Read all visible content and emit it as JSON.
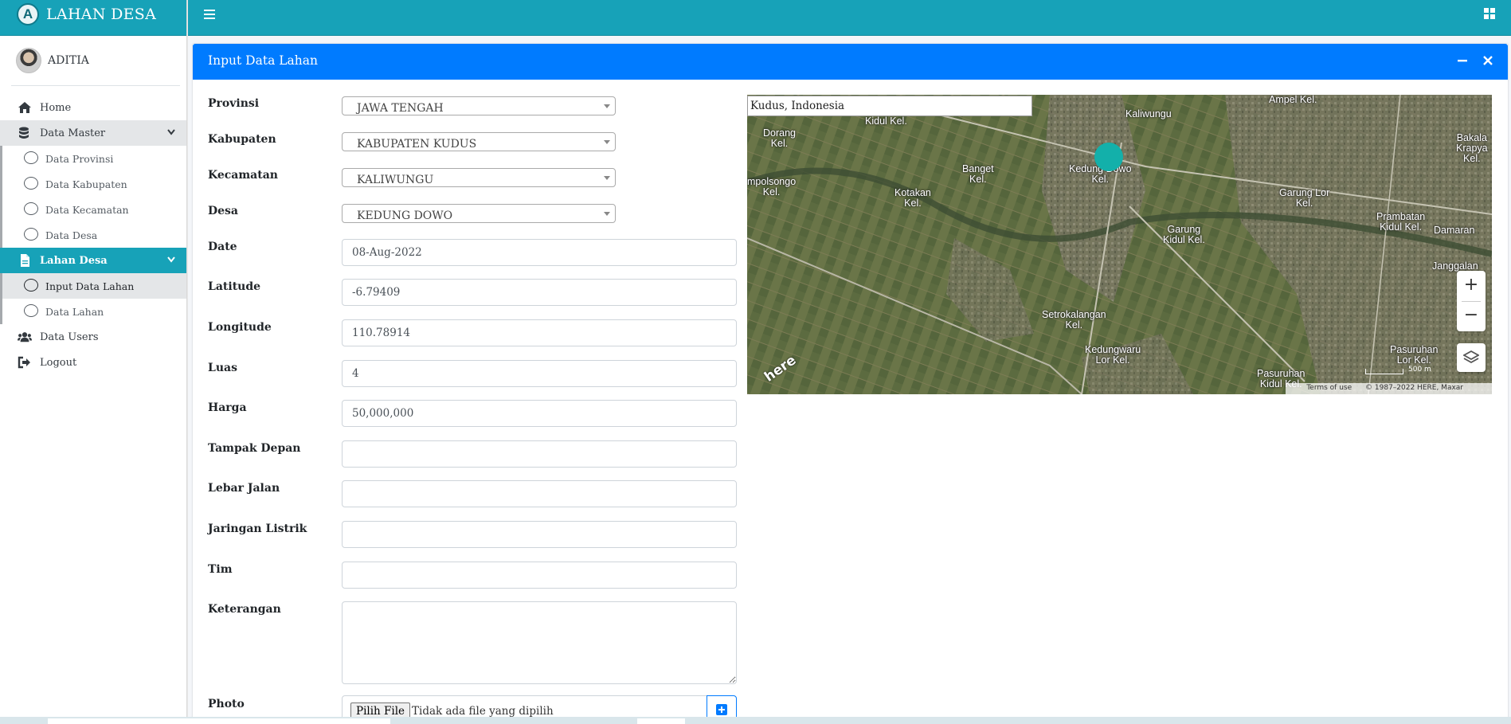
{
  "app": {
    "brand": "LAHAN DESA",
    "brand_logo_letter": "A",
    "user": "ADITIA"
  },
  "sidebar": {
    "items": [
      {
        "label": "Home",
        "icon": "home-icon"
      },
      {
        "label": "Data Master",
        "icon": "database-icon",
        "expanded": true,
        "children": [
          "Data Provinsi",
          "Data Kabupaten",
          "Data Kecamatan",
          "Data Desa"
        ]
      },
      {
        "label": "Lahan Desa",
        "icon": "file-icon",
        "expanded": true,
        "active": true,
        "children": [
          "Input Data Lahan",
          "Data Lahan"
        ],
        "active_child": "Input Data Lahan"
      },
      {
        "label": "Data Users",
        "icon": "users-icon"
      },
      {
        "label": "Logout",
        "icon": "sign-out-icon"
      }
    ]
  },
  "card": {
    "title": "Input Data Lahan"
  },
  "form": {
    "provinsi": {
      "label": "Provinsi",
      "value": "JAWA TENGAH"
    },
    "kabupaten": {
      "label": "Kabupaten",
      "value": "KABUPATEN KUDUS"
    },
    "kecamatan": {
      "label": "Kecamatan",
      "value": "KALIWUNGU"
    },
    "desa": {
      "label": "Desa",
      "value": "KEDUNG DOWO"
    },
    "date": {
      "label": "Date",
      "value": "08-Aug-2022"
    },
    "latitude": {
      "label": "Latitude",
      "value": "-6.79409"
    },
    "longitude": {
      "label": "Longitude",
      "value": "110.78914"
    },
    "luas": {
      "label": "Luas",
      "value": "4"
    },
    "harga": {
      "label": "Harga",
      "value": "50,000,000"
    },
    "tampak_depan": {
      "label": "Tampak Depan",
      "value": ""
    },
    "lebar_jalan": {
      "label": "Lebar Jalan",
      "value": ""
    },
    "jaringan_listrik": {
      "label": "Jaringan Listrik",
      "value": ""
    },
    "tim": {
      "label": "Tim",
      "value": ""
    },
    "keterangan": {
      "label": "Keterangan",
      "value": ""
    },
    "photo": {
      "label": "Photo",
      "button": "Pilih File",
      "status": "Tidak ada file yang dipilih"
    }
  },
  "map": {
    "search_value": "Kudus, Indonesia",
    "zoom_in": "+",
    "zoom_out": "−",
    "terms": "Terms of use",
    "copyright": "© 1987–2022 HERE, Maxar",
    "logo": "here",
    "scale": "500 m",
    "labels": [
      "Ampel Kel.",
      "Kidul Kel.",
      "Kaliwungu",
      "Dorang\nKel.",
      "Banget\nKel.",
      "Kedung Dowo\nKel.",
      "mpolsongo\nKel.",
      "Kotakan\nKel.",
      "Garung Lor\nKel.",
      "Bakala\nKrapya\nKel.",
      "Prambatan\nKidul Kel.",
      "Garung\nKidul Kel.",
      "Damaran",
      "Janggalan",
      "Setrokalangan\nKel.",
      "Kedungwaru\nLor Kel.",
      "Pasuruhan\nLor Kel.",
      "Pasuruhan\nKidul Kel."
    ]
  },
  "colors": {
    "primary": "#007bff",
    "teal": "#17a2b8",
    "marker": "#13b0aa"
  }
}
